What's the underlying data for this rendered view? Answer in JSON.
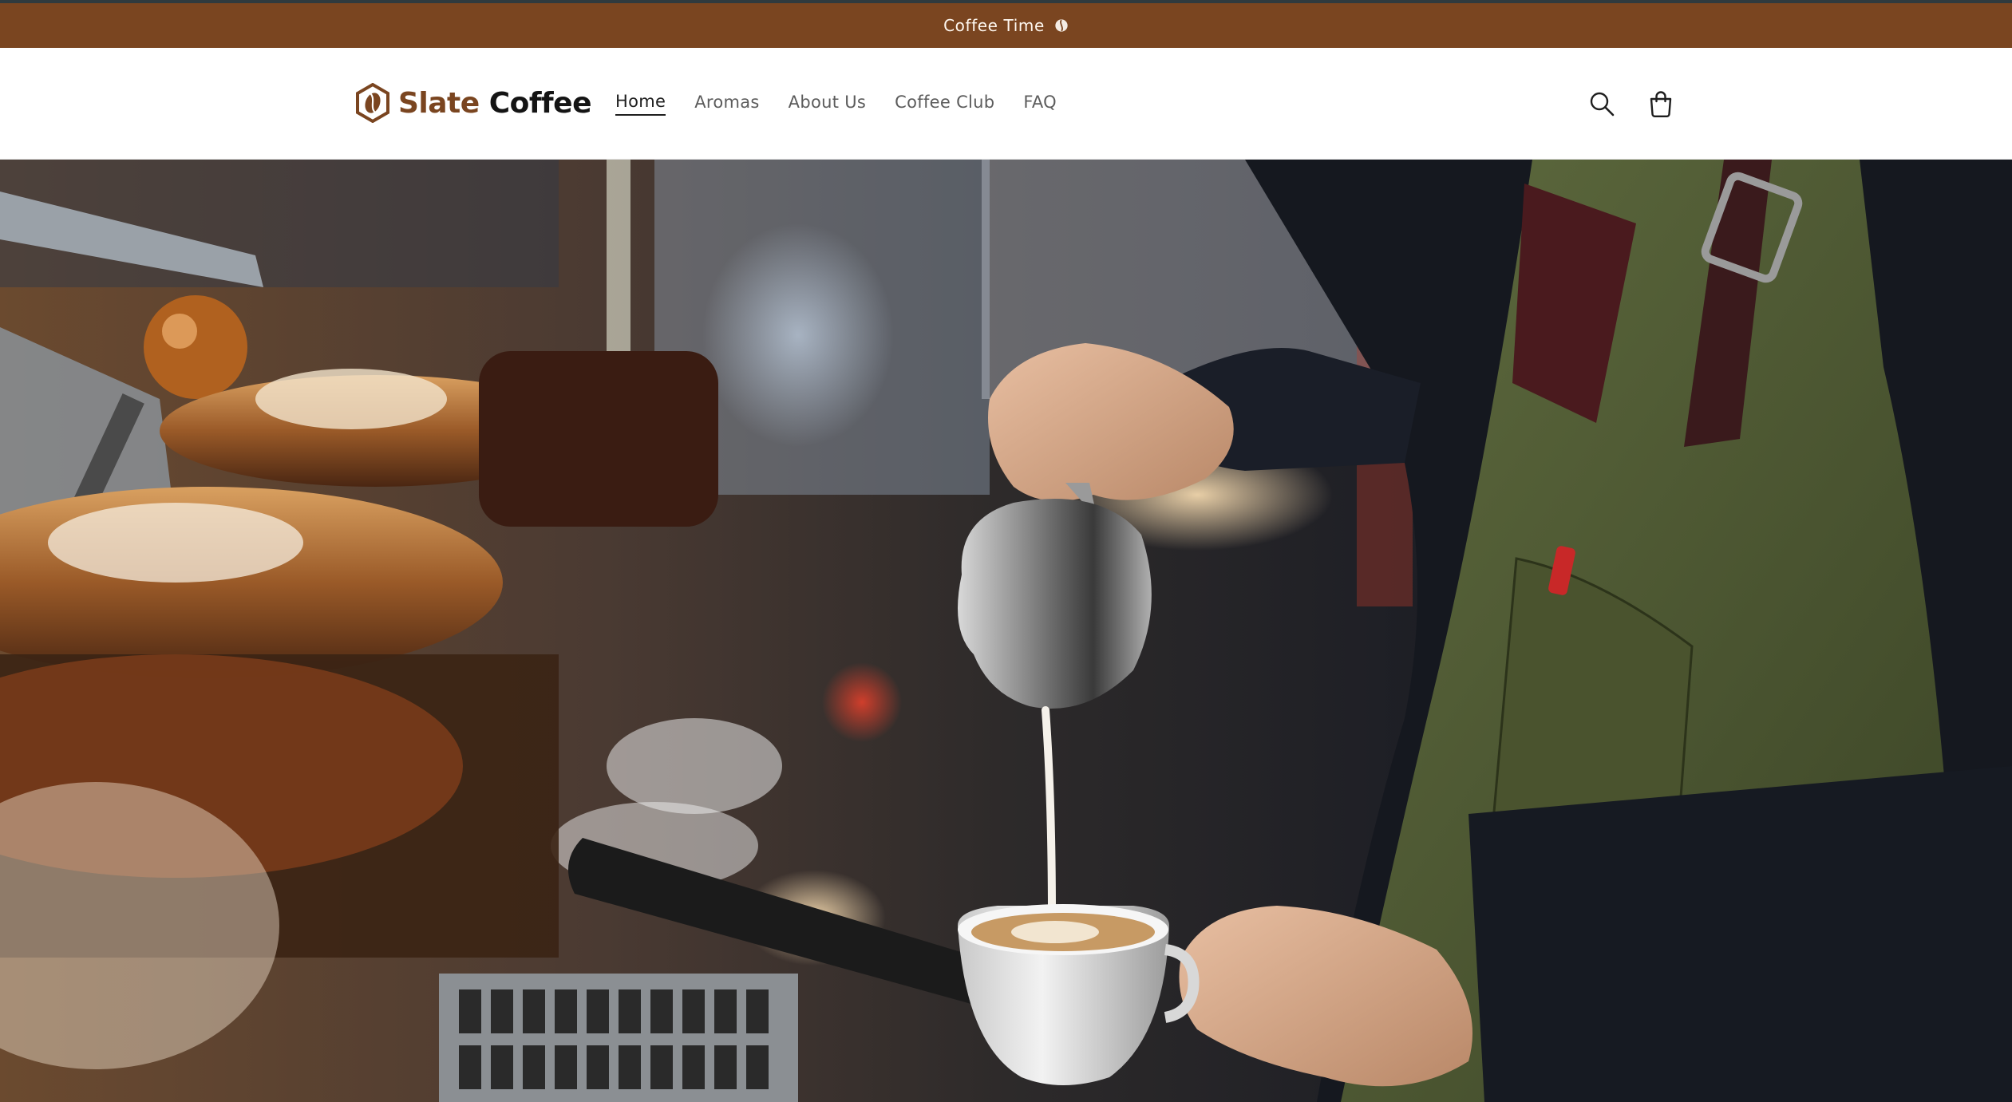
{
  "announcement": {
    "text": "Coffee Time",
    "icon": "coffee-bean-icon"
  },
  "brand": {
    "name_part1": "Slate",
    "name_part2": "Coffee",
    "logo_icon": "coffee-bean-hexagon-icon",
    "accent": "#7a4520"
  },
  "nav": {
    "items": [
      {
        "label": "Home",
        "active": true
      },
      {
        "label": "Aromas",
        "active": false
      },
      {
        "label": "About Us",
        "active": false
      },
      {
        "label": "Coffee Club",
        "active": false
      },
      {
        "label": "FAQ",
        "active": false
      }
    ]
  },
  "header_icons": {
    "search": "search-icon",
    "cart": "cart-icon"
  },
  "hero": {
    "image": "barista-pouring-latte-art-photo"
  }
}
